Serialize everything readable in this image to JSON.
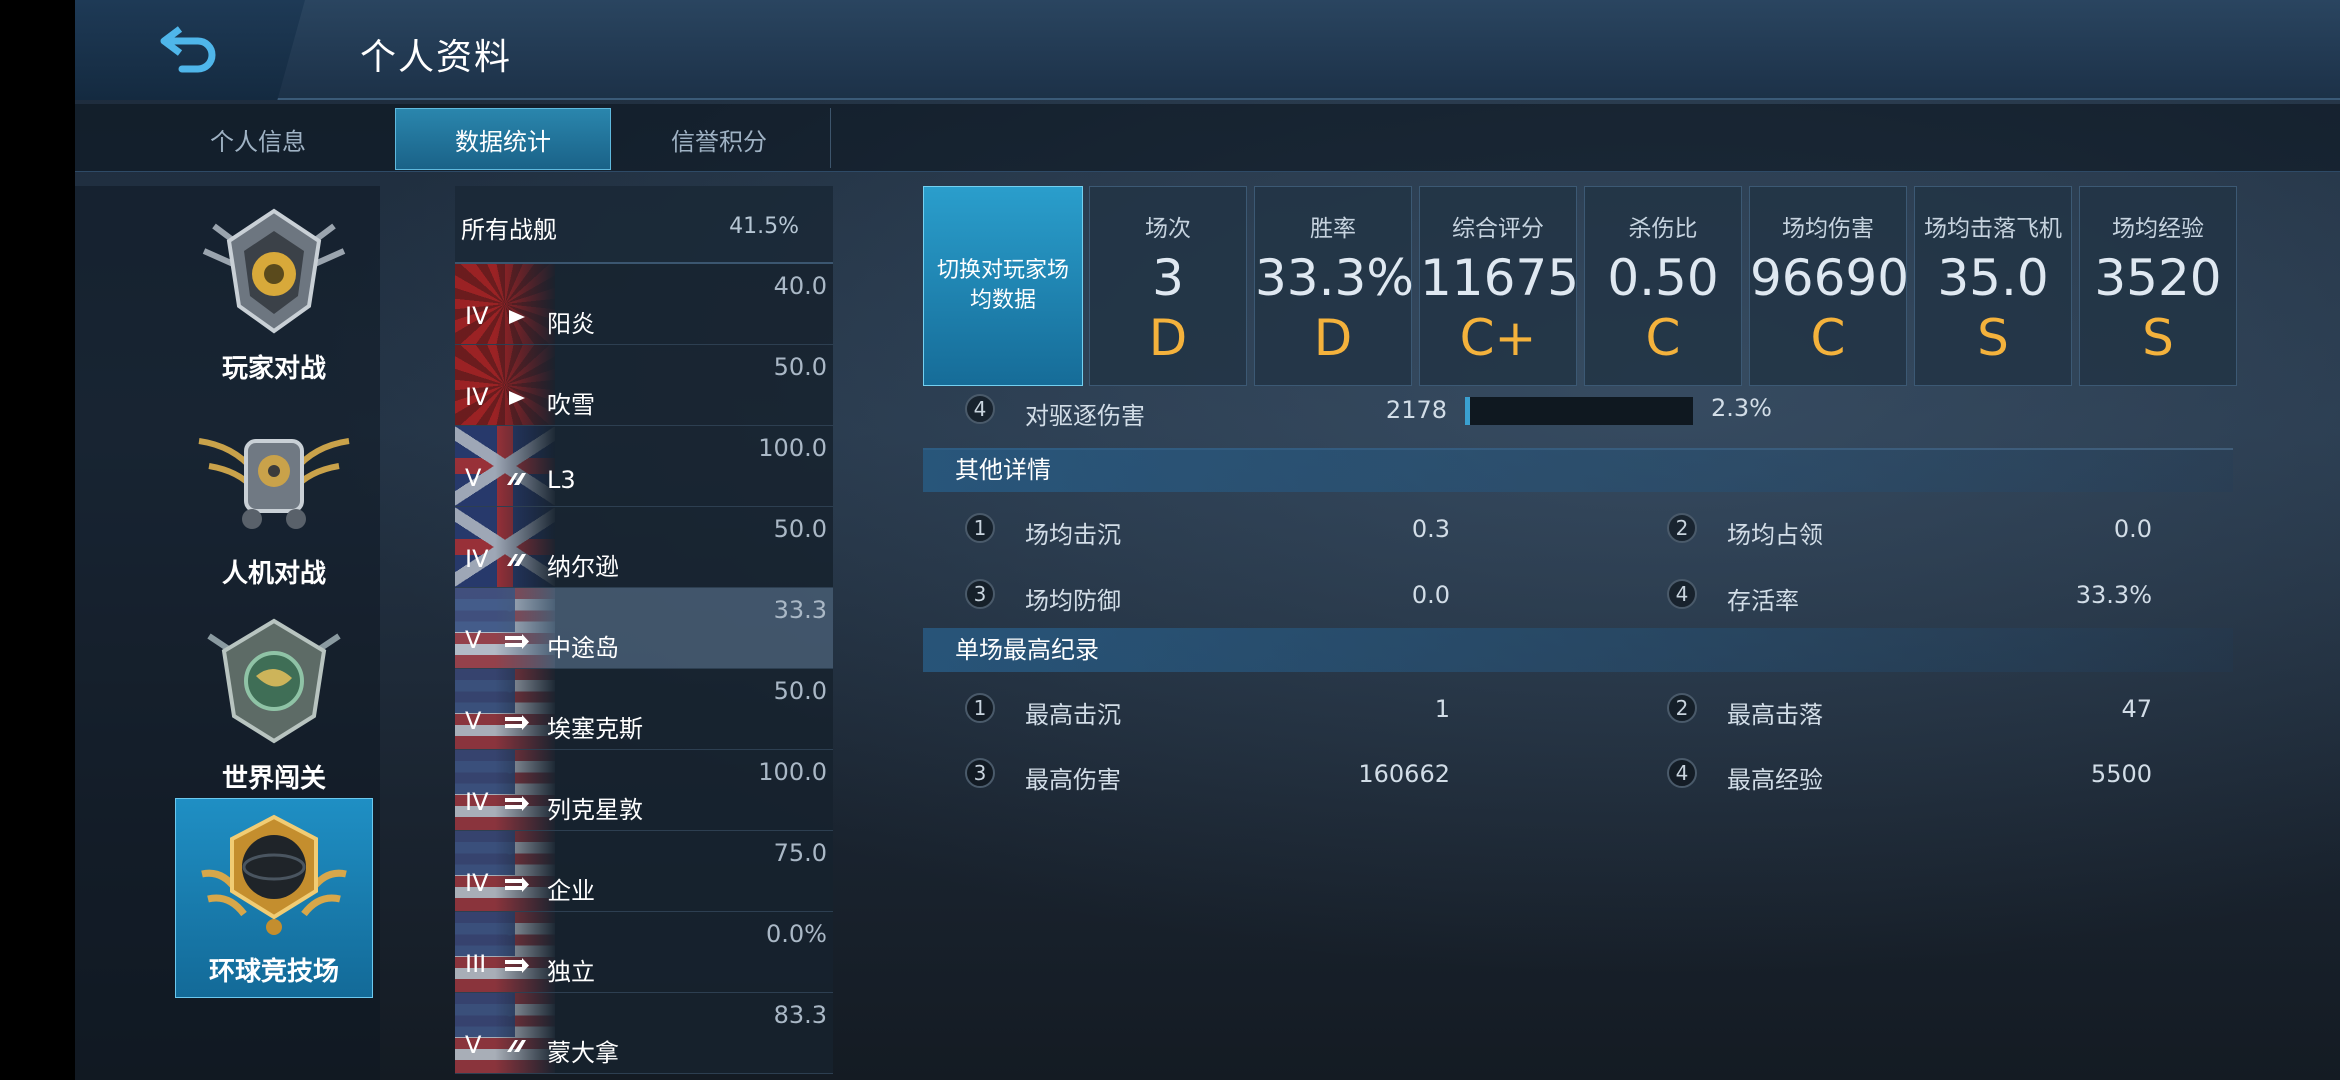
{
  "header": {
    "title": "个人资料",
    "back_icon": "back-arrow-icon"
  },
  "tabs": [
    {
      "label": "个人信息",
      "active": false
    },
    {
      "label": "数据统计",
      "active": true
    },
    {
      "label": "信誉积分",
      "active": false
    }
  ],
  "modes": [
    {
      "label": "玩家对战",
      "active": false
    },
    {
      "label": "人机对战",
      "active": false
    },
    {
      "label": "世界闯关",
      "active": false
    },
    {
      "label": "环球竞技场",
      "active": true
    }
  ],
  "ship_list": {
    "all": {
      "name": "所有战舰",
      "win_rate": "41.5%"
    },
    "items": [
      {
        "tier": "IV",
        "type": "destroyer-icon",
        "name": "阳炎",
        "win_rate": "40.0",
        "flag": "jp"
      },
      {
        "tier": "IV",
        "type": "destroyer-icon",
        "name": "吹雪",
        "win_rate": "50.0",
        "flag": "jp"
      },
      {
        "tier": "V",
        "type": "cruiser-icon",
        "name": "L3",
        "win_rate": "100.0",
        "flag": "uk"
      },
      {
        "tier": "IV",
        "type": "cruiser-icon",
        "name": "纳尔逊",
        "win_rate": "50.0",
        "flag": "uk"
      },
      {
        "tier": "V",
        "type": "carrier-icon",
        "name": "中途岛",
        "win_rate": "33.3",
        "flag": "us",
        "selected": true
      },
      {
        "tier": "V",
        "type": "carrier-icon",
        "name": "埃塞克斯",
        "win_rate": "50.0",
        "flag": "us"
      },
      {
        "tier": "IV",
        "type": "carrier-icon",
        "name": "列克星敦",
        "win_rate": "100.0",
        "flag": "us"
      },
      {
        "tier": "IV",
        "type": "carrier-icon",
        "name": "企业",
        "win_rate": "75.0",
        "flag": "us"
      },
      {
        "tier": "III",
        "type": "carrier-icon",
        "name": "独立",
        "win_rate": "0.0%",
        "flag": "us"
      },
      {
        "tier": "V",
        "type": "cruiser-icon",
        "name": "蒙大拿",
        "win_rate": "83.3",
        "flag": "us"
      }
    ]
  },
  "switch_button": "切换对玩家场均数据",
  "stats": [
    {
      "label": "场次",
      "value": "3",
      "grade": "D"
    },
    {
      "label": "胜率",
      "value": "33.3%",
      "grade": "D"
    },
    {
      "label": "综合评分",
      "value": "11675",
      "grade": "C+"
    },
    {
      "label": "杀伤比",
      "value": "0.50",
      "grade": "C"
    },
    {
      "label": "场均伤害",
      "value": "96690",
      "grade": "C"
    },
    {
      "label": "场均击落飞机",
      "value": "35.0",
      "grade": "S"
    },
    {
      "label": "场均经验",
      "value": "3520",
      "grade": "S"
    }
  ],
  "damage_row": {
    "index": "4",
    "label": "对驱逐伤害",
    "value": "2178",
    "percent": "2.3%",
    "fraction": 0.023
  },
  "other_details": {
    "title": "其他详情",
    "items": [
      {
        "index": "1",
        "label": "场均击沉",
        "value": "0.3"
      },
      {
        "index": "2",
        "label": "场均占领",
        "value": "0.0"
      },
      {
        "index": "3",
        "label": "场均防御",
        "value": "0.0"
      },
      {
        "index": "4",
        "label": "存活率",
        "value": "33.3%"
      }
    ]
  },
  "records": {
    "title": "单场最高纪录",
    "items": [
      {
        "index": "1",
        "label": "最高击沉",
        "value": "1"
      },
      {
        "index": "2",
        "label": "最高击落",
        "value": "47"
      },
      {
        "index": "3",
        "label": "最高伤害",
        "value": "160662"
      },
      {
        "index": "4",
        "label": "最高经验",
        "value": "5500"
      }
    ]
  },
  "colors": {
    "accent": "#2a9ecc",
    "grade": "#f4b23c"
  }
}
